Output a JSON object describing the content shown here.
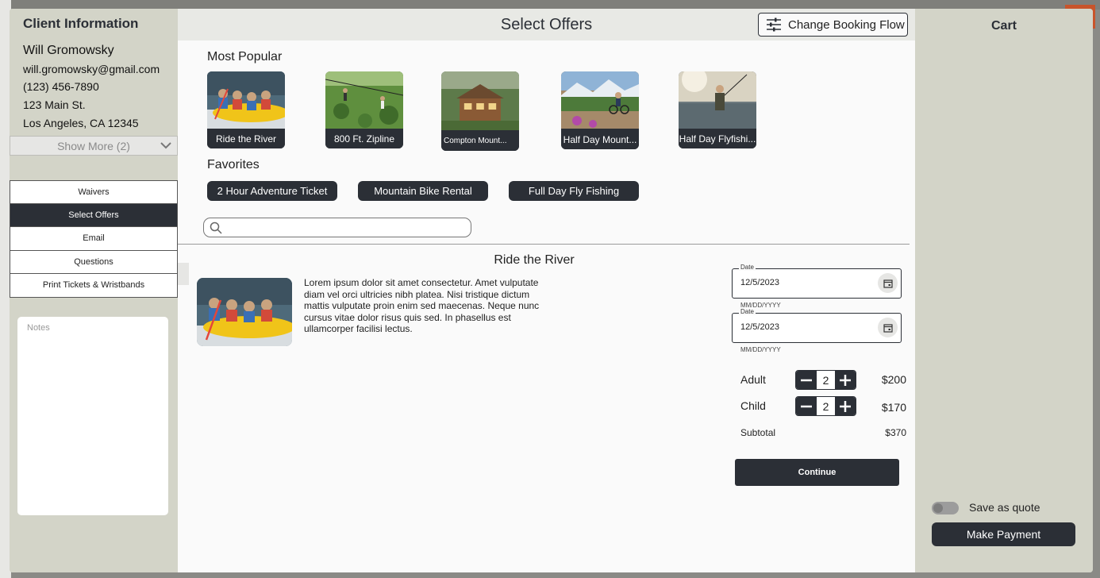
{
  "client": {
    "section_title": "Client Information",
    "name": "Will Gromowsky",
    "email": "will.gromowsky@gmail.com",
    "phone": "(123) 456-7890",
    "address_line1": "123 Main St.",
    "address_line2": "Los Angeles, CA 12345",
    "show_more_label": "Show More (2)"
  },
  "nav": {
    "items": [
      {
        "label": "Waivers",
        "active": false
      },
      {
        "label": "Select Offers",
        "active": true
      },
      {
        "label": "Email",
        "active": false
      },
      {
        "label": "Questions",
        "active": false
      },
      {
        "label": "Print Tickets & Wristbands",
        "active": false
      }
    ]
  },
  "notes": {
    "placeholder": "Notes"
  },
  "main": {
    "title": "Select Offers",
    "change_flow_label": "Change Booking Flow",
    "most_popular_label": "Most Popular",
    "popular": [
      {
        "caption": "Ride the River"
      },
      {
        "caption": "800 Ft. Zipline"
      },
      {
        "caption": "Compton Mount..."
      },
      {
        "caption": "Half Day Mount..."
      },
      {
        "caption": "Half Day Flyfishi..."
      }
    ],
    "favorites_label": "Favorites",
    "favorites": [
      {
        "label": "2 Hour Adventure Ticket"
      },
      {
        "label": "Mountain Bike Rental"
      },
      {
        "label": "Full Day Fly Fishing"
      }
    ],
    "search_placeholder": ""
  },
  "offer": {
    "title": "Ride the River",
    "description": "Lorem ipsum dolor sit amet consectetur. Amet vulputate diam vel orci ultricies nibh platea. Nisi tristique dictum mattis vulputate proin enim sed maecenas. Neque nunc cursus vitae dolor risus quis sed. In phasellus est ullamcorper facilisi lectus.",
    "dates": [
      {
        "legend": "Date",
        "value": "12/5/2023",
        "hint": "MM/DD/YYYY"
      },
      {
        "legend": "Date",
        "value": "12/5/2023",
        "hint": "MM/DD/YYYY"
      }
    ],
    "tickets": [
      {
        "label": "Adult",
        "qty": "2",
        "price": "$200"
      },
      {
        "label": "Child",
        "qty": "2",
        "price": "$170"
      }
    ],
    "subtotal_label": "Subtotal",
    "subtotal_value": "$370",
    "continue_label": "Continue"
  },
  "cart": {
    "title": "Cart",
    "save_quote_label": "Save as quote",
    "save_quote_on": false,
    "make_payment_label": "Make Payment"
  },
  "colors": {
    "dark": "#2b2f36",
    "panel": "#d3d4c8",
    "main_bg": "#fafafa"
  }
}
